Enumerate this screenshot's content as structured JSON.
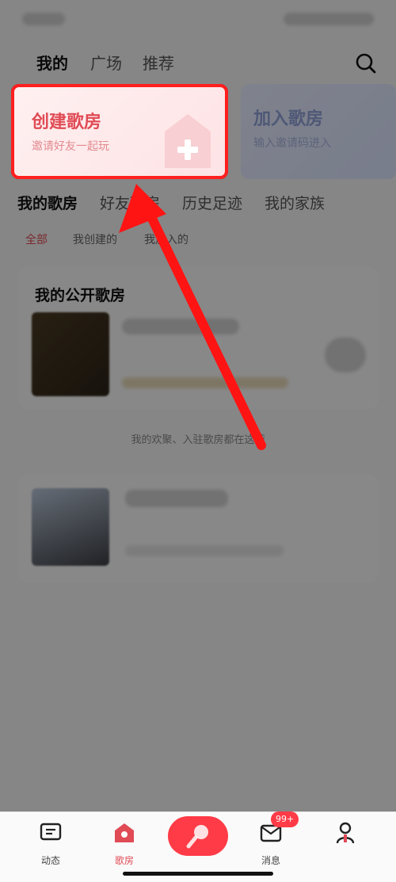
{
  "top_tabs": [
    "我的",
    "广场",
    "推荐"
  ],
  "cards": {
    "create": {
      "title": "创建歌房",
      "subtitle": "邀请好友一起玩"
    },
    "join": {
      "title": "加入歌房",
      "subtitle": "输入邀请码进入"
    }
  },
  "sub_tabs": [
    "我的歌房",
    "好友歌房",
    "历史足迹",
    "我的家族"
  ],
  "filters": [
    "全部",
    "我创建的",
    "我加入的"
  ],
  "public_rooms": {
    "title": "我的公开歌房"
  },
  "hint": "我的欢聚、入驻歌房都在这哦",
  "bottom_nav": {
    "dynamics": "动态",
    "rooms": "歌房",
    "messages": "消息",
    "badge": "99+"
  },
  "colors": {
    "accent": "#ff3b47",
    "highlight": "#ff1f1f"
  },
  "icons": [
    "search-icon",
    "plus-icon",
    "chat-icon",
    "house-icon",
    "mic-icon",
    "mail-icon",
    "profile-icon"
  ]
}
